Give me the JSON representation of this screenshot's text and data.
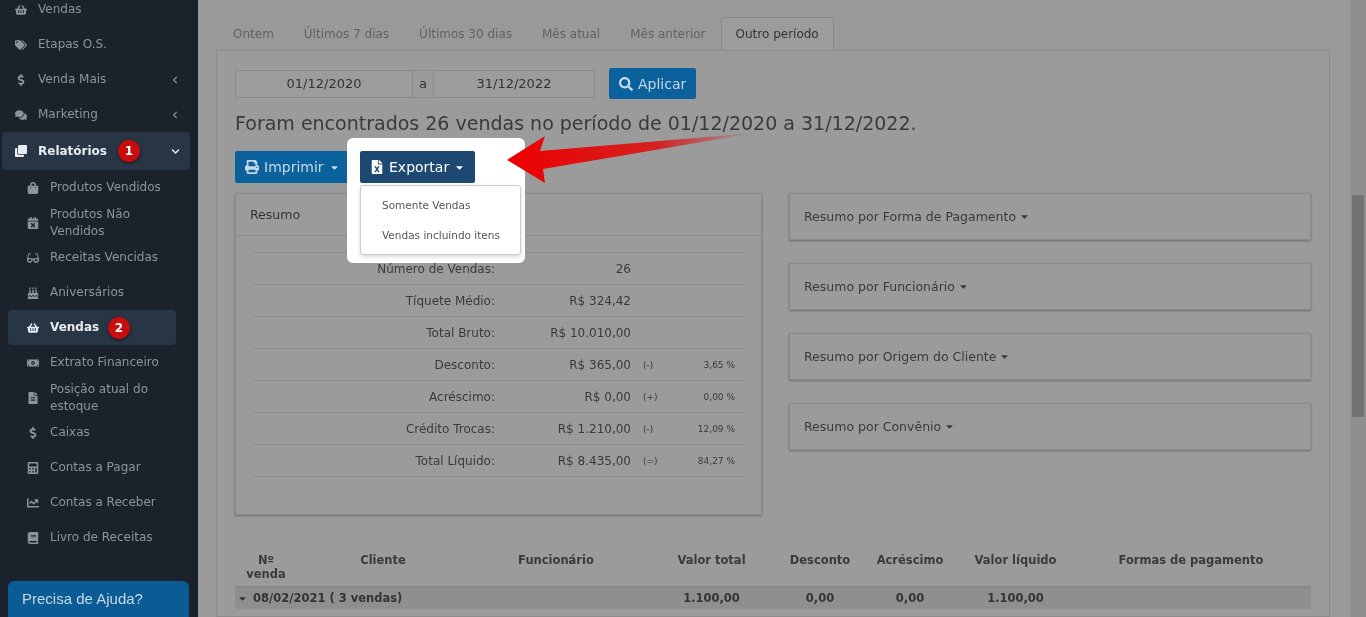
{
  "sidebar": {
    "items": [
      {
        "label": "Vendas",
        "selected": false
      },
      {
        "label": "Etapas O.S.",
        "selected": false
      },
      {
        "label": "Venda Mais",
        "selected": false,
        "submenu": true
      },
      {
        "label": "Marketing",
        "selected": false,
        "submenu": true
      },
      {
        "label": "Relatórios",
        "selected": true,
        "expanded": true,
        "badge": "1",
        "children": [
          {
            "label": "Produtos Vendidos",
            "selected": false
          },
          {
            "label": "Produtos Não Vendidos",
            "selected": false
          },
          {
            "label": "Receitas Vencidas",
            "selected": false
          },
          {
            "label": "Aniversários",
            "selected": false
          },
          {
            "label": "Vendas",
            "selected": true,
            "badge": "2"
          },
          {
            "label": "Extrato Financeiro",
            "selected": false
          },
          {
            "label": "Posição atual do estoque",
            "selected": false
          },
          {
            "label": "Caixas",
            "selected": false
          },
          {
            "label": "Contas a Pagar",
            "selected": false
          },
          {
            "label": "Contas a Receber",
            "selected": false
          },
          {
            "label": "Livro de Receitas",
            "selected": false
          }
        ]
      }
    ],
    "help": "Precisa de Ajuda?"
  },
  "tabs": [
    {
      "label": "Ontem",
      "selected": false
    },
    {
      "label": "Últimos 7 dias",
      "selected": false
    },
    {
      "label": "Últimos 30 dias",
      "selected": false
    },
    {
      "label": "Mês atual",
      "selected": false
    },
    {
      "label": "Mês anterior",
      "selected": false
    },
    {
      "label": "Outro período",
      "selected": true
    }
  ],
  "date_range": {
    "start": "01/12/2020",
    "separator": "a",
    "end": "31/12/2022",
    "apply": "Aplicar"
  },
  "result_text": "Foram encontrados 26 vendas no período de 01/12/2020 a 31/12/2022.",
  "print_button": "Imprimir",
  "export_button": "Exportar",
  "export_menu": [
    "Somente Vendas",
    "Vendas incluindo itens"
  ],
  "summary": {
    "title": "Resumo",
    "rows": [
      {
        "label": "Número de Vendas:",
        "value": "26"
      },
      {
        "label": "Tíquete Médio:",
        "value": "R$ 324,42"
      },
      {
        "label": "Total Bruto:",
        "value": "R$ 10.010,00"
      },
      {
        "label": "Desconto:",
        "value": "R$ 365,00",
        "sign": "(-)",
        "percent": "3,65 %"
      },
      {
        "label": "Acréscimo:",
        "value": "R$ 0,00",
        "sign": "(+)",
        "percent": "0,00 %"
      },
      {
        "label": "Crédito Trocas:",
        "value": "R$ 1.210,00",
        "sign": "(-)",
        "percent": "12,09 %"
      },
      {
        "label": "Total Líquido:",
        "value": "R$ 8.435,00",
        "sign": "(=)",
        "percent": "84,27 %"
      }
    ]
  },
  "side_panels": [
    "Resumo por Forma de Pagamento",
    "Resumo por Funcionário",
    "Resumo por Origem do Cliente",
    "Resumo por Convênio"
  ],
  "table": {
    "columns": [
      "Nº venda",
      "Cliente",
      "Funcionário",
      "Valor total",
      "Desconto",
      "Acréscimo",
      "Valor líquido",
      "Formas de pagamento"
    ],
    "rows": [
      {
        "kind": "group",
        "expanded": true,
        "cells": [
          "08/02/2021 ( 3 vendas)",
          "",
          "",
          "1.100,00",
          "0,00",
          "0,00",
          "1.100,00",
          ""
        ]
      }
    ]
  }
}
